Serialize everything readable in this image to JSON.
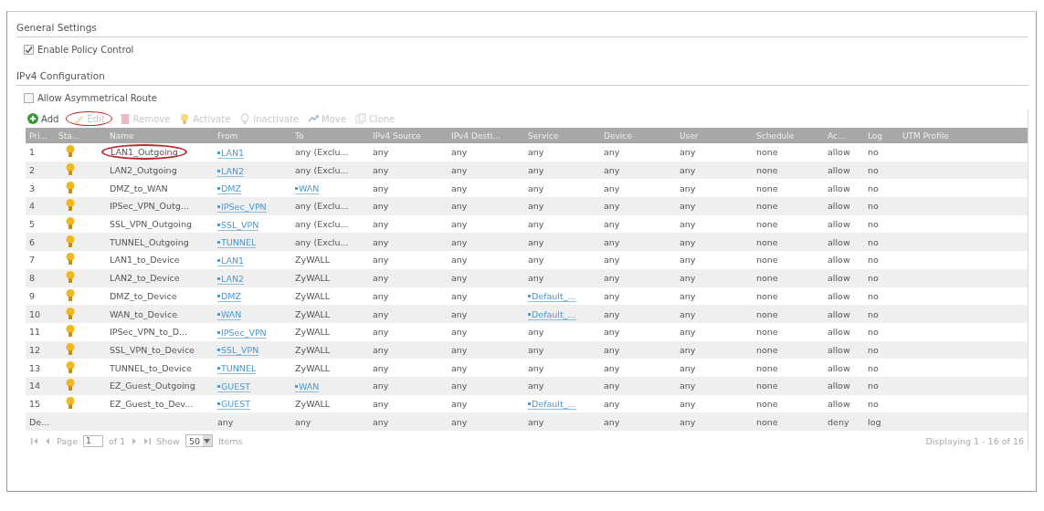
{
  "general_settings": {
    "title": "General Settings",
    "enable_policy_control": {
      "label": "Enable Policy Control",
      "checked": true
    }
  },
  "ipv4": {
    "title": "IPv4 Configuration",
    "allow_asymmetrical_route": {
      "label": "Allow Asymmetrical Route",
      "checked": false
    },
    "toolbar": [
      {
        "kind": "add",
        "label": "Add",
        "disabled": false,
        "circled": false
      },
      {
        "kind": "edit",
        "label": "Edit",
        "disabled": true,
        "circled": true
      },
      {
        "kind": "remove",
        "label": "Remove",
        "disabled": true,
        "circled": false
      },
      {
        "kind": "activate",
        "label": "Activate",
        "disabled": true,
        "circled": false
      },
      {
        "kind": "inactivate",
        "label": "Inactivate",
        "disabled": true,
        "circled": false
      },
      {
        "kind": "move",
        "label": "Move",
        "disabled": true,
        "circled": false
      },
      {
        "kind": "clone",
        "label": "Clone",
        "disabled": true,
        "circled": false
      }
    ],
    "table": {
      "columns": [
        "Pri...",
        "Sta...",
        "Name",
        "From",
        "To",
        "IPv4 Source",
        "IPv4 Desti...",
        "Service",
        "Device",
        "User",
        "Schedule",
        "Ac...",
        "Log",
        "UTM Profile"
      ],
      "rows": [
        {
          "priority": "1",
          "active": true,
          "name": "LAN1_Outgoing",
          "name_circled": true,
          "from": {
            "text": "LAN1",
            "link": true
          },
          "to": {
            "text": "any (Exclu...",
            "link": false
          },
          "source": "any",
          "destination": "any",
          "service": {
            "text": "any",
            "link": false
          },
          "device": "any",
          "user": "any",
          "schedule": "none",
          "action": "allow",
          "log": "no"
        },
        {
          "priority": "2",
          "active": true,
          "name": "LAN2_Outgoing",
          "name_circled": false,
          "from": {
            "text": "LAN2",
            "link": true
          },
          "to": {
            "text": "any (Exclu...",
            "link": false
          },
          "source": "any",
          "destination": "any",
          "service": {
            "text": "any",
            "link": false
          },
          "device": "any",
          "user": "any",
          "schedule": "none",
          "action": "allow",
          "log": "no"
        },
        {
          "priority": "3",
          "active": true,
          "name": "DMZ_to_WAN",
          "name_circled": false,
          "from": {
            "text": "DMZ",
            "link": true
          },
          "to": {
            "text": "WAN",
            "link": true
          },
          "source": "any",
          "destination": "any",
          "service": {
            "text": "any",
            "link": false
          },
          "device": "any",
          "user": "any",
          "schedule": "none",
          "action": "allow",
          "log": "no"
        },
        {
          "priority": "4",
          "active": true,
          "name": "IPSec_VPN_Outg...",
          "name_circled": false,
          "from": {
            "text": "IPSec_VPN",
            "link": true
          },
          "to": {
            "text": "any (Exclu...",
            "link": false
          },
          "source": "any",
          "destination": "any",
          "service": {
            "text": "any",
            "link": false
          },
          "device": "any",
          "user": "any",
          "schedule": "none",
          "action": "allow",
          "log": "no"
        },
        {
          "priority": "5",
          "active": true,
          "name": "SSL_VPN_Outgoing",
          "name_circled": false,
          "from": {
            "text": "SSL_VPN",
            "link": true
          },
          "to": {
            "text": "any (Exclu...",
            "link": false
          },
          "source": "any",
          "destination": "any",
          "service": {
            "text": "any",
            "link": false
          },
          "device": "any",
          "user": "any",
          "schedule": "none",
          "action": "allow",
          "log": "no"
        },
        {
          "priority": "6",
          "active": true,
          "name": "TUNNEL_Outgoing",
          "name_circled": false,
          "from": {
            "text": "TUNNEL",
            "link": true
          },
          "to": {
            "text": "any (Exclu...",
            "link": false
          },
          "source": "any",
          "destination": "any",
          "service": {
            "text": "any",
            "link": false
          },
          "device": "any",
          "user": "any",
          "schedule": "none",
          "action": "allow",
          "log": "no"
        },
        {
          "priority": "7",
          "active": true,
          "name": "LAN1_to_Device",
          "name_circled": false,
          "from": {
            "text": "LAN1",
            "link": true
          },
          "to": {
            "text": "ZyWALL",
            "link": false
          },
          "source": "any",
          "destination": "any",
          "service": {
            "text": "any",
            "link": false
          },
          "device": "any",
          "user": "any",
          "schedule": "none",
          "action": "allow",
          "log": "no"
        },
        {
          "priority": "8",
          "active": true,
          "name": "LAN2_to_Device",
          "name_circled": false,
          "from": {
            "text": "LAN2",
            "link": true
          },
          "to": {
            "text": "ZyWALL",
            "link": false
          },
          "source": "any",
          "destination": "any",
          "service": {
            "text": "any",
            "link": false
          },
          "device": "any",
          "user": "any",
          "schedule": "none",
          "action": "allow",
          "log": "no"
        },
        {
          "priority": "9",
          "active": true,
          "name": "DMZ_to_Device",
          "name_circled": false,
          "from": {
            "text": "DMZ",
            "link": true
          },
          "to": {
            "text": "ZyWALL",
            "link": false
          },
          "source": "any",
          "destination": "any",
          "service": {
            "text": "Default_...",
            "link": true
          },
          "device": "any",
          "user": "any",
          "schedule": "none",
          "action": "allow",
          "log": "no"
        },
        {
          "priority": "10",
          "active": true,
          "name": "WAN_to_Device",
          "name_circled": false,
          "from": {
            "text": "WAN",
            "link": true
          },
          "to": {
            "text": "ZyWALL",
            "link": false
          },
          "source": "any",
          "destination": "any",
          "service": {
            "text": "Default_...",
            "link": true
          },
          "device": "any",
          "user": "any",
          "schedule": "none",
          "action": "allow",
          "log": "no"
        },
        {
          "priority": "11",
          "active": true,
          "name": "IPSec_VPN_to_D...",
          "name_circled": false,
          "from": {
            "text": "IPSec_VPN",
            "link": true
          },
          "to": {
            "text": "ZyWALL",
            "link": false
          },
          "source": "any",
          "destination": "any",
          "service": {
            "text": "any",
            "link": false
          },
          "device": "any",
          "user": "any",
          "schedule": "none",
          "action": "allow",
          "log": "no"
        },
        {
          "priority": "12",
          "active": true,
          "name": "SSL_VPN_to_Device",
          "name_circled": false,
          "from": {
            "text": "SSL_VPN",
            "link": true
          },
          "to": {
            "text": "ZyWALL",
            "link": false
          },
          "source": "any",
          "destination": "any",
          "service": {
            "text": "any",
            "link": false
          },
          "device": "any",
          "user": "any",
          "schedule": "none",
          "action": "allow",
          "log": "no"
        },
        {
          "priority": "13",
          "active": true,
          "name": "TUNNEL_to_Device",
          "name_circled": false,
          "from": {
            "text": "TUNNEL",
            "link": true
          },
          "to": {
            "text": "ZyWALL",
            "link": false
          },
          "source": "any",
          "destination": "any",
          "service": {
            "text": "any",
            "link": false
          },
          "device": "any",
          "user": "any",
          "schedule": "none",
          "action": "allow",
          "log": "no"
        },
        {
          "priority": "14",
          "active": true,
          "name": "EZ_Guest_Outgoing",
          "name_circled": false,
          "from": {
            "text": "GUEST",
            "link": true
          },
          "to": {
            "text": "WAN",
            "link": true
          },
          "source": "any",
          "destination": "any",
          "service": {
            "text": "any",
            "link": false
          },
          "device": "any",
          "user": "any",
          "schedule": "none",
          "action": "allow",
          "log": "no"
        },
        {
          "priority": "15",
          "active": true,
          "name": "EZ_Guest_to_Dev...",
          "name_circled": false,
          "from": {
            "text": "GUEST",
            "link": true
          },
          "to": {
            "text": "ZyWALL",
            "link": false
          },
          "source": "any",
          "destination": "any",
          "service": {
            "text": "Default_...",
            "link": true
          },
          "device": "any",
          "user": "any",
          "schedule": "none",
          "action": "allow",
          "log": "no"
        },
        {
          "priority": "De...",
          "from": {
            "text": "any",
            "link": false
          },
          "to": {
            "text": "any",
            "link": false
          },
          "source": "any",
          "destination": "any",
          "service": {
            "text": "any",
            "link": false
          },
          "device": "any",
          "user": "any",
          "schedule": "none",
          "action": "deny",
          "log": "log"
        }
      ]
    },
    "pager": {
      "page_label": "Page",
      "page": "1",
      "of": "of 1",
      "show_label": "Show",
      "per_page": "50",
      "items_label": "Items",
      "displaying": "Displaying 1 - 16 of 16"
    }
  }
}
